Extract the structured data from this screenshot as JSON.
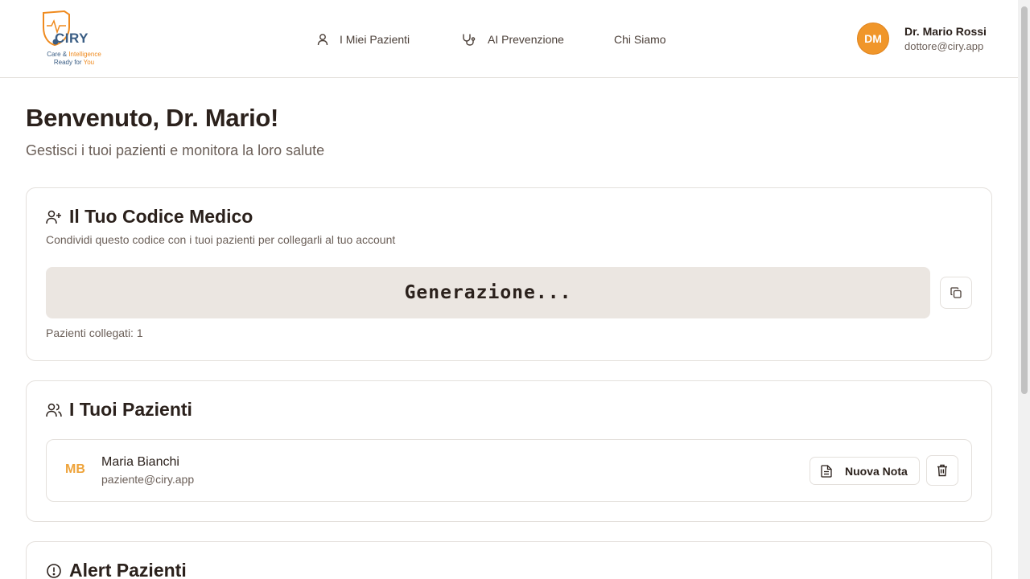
{
  "header": {
    "logo": {
      "word": "CIRY",
      "tagline_prefix": "Care & ",
      "tagline_accent": "Intelligence",
      "tagline_line2": "Ready for ",
      "tagline_line2_accent": "You"
    },
    "nav": [
      {
        "label": "I Miei Pazienti",
        "icon": "user-icon"
      },
      {
        "label": "AI Prevenzione",
        "icon": "stethoscope-icon"
      },
      {
        "label": "Chi Siamo"
      }
    ],
    "user": {
      "initials": "DM",
      "name": "Dr. Mario Rossi",
      "email": "dottore@ciry.app"
    }
  },
  "main": {
    "welcome": "Benvenuto, Dr. Mario!",
    "subtitle": "Gestisci i tuoi pazienti e monitora la loro salute",
    "code_card": {
      "title": "Il Tuo Codice Medico",
      "description": "Condividi questo codice con i tuoi pazienti per collegarli al tuo account",
      "code": "Generazione...",
      "linked": "Pazienti collegati: 1"
    },
    "patients_card": {
      "title": "I Tuoi Pazienti",
      "patients": [
        {
          "initials": "MB",
          "name": "Maria Bianchi",
          "email": "paziente@ciry.app",
          "note_label": "Nuova Nota"
        }
      ]
    },
    "alert_card": {
      "title": "Alert Pazienti"
    }
  },
  "colors": {
    "accent": "#f0962a",
    "brand_blue": "#3a5d84",
    "code_background": "#ebe6e1",
    "text_primary": "#2b211c",
    "text_secondary": "#6b5f58"
  }
}
